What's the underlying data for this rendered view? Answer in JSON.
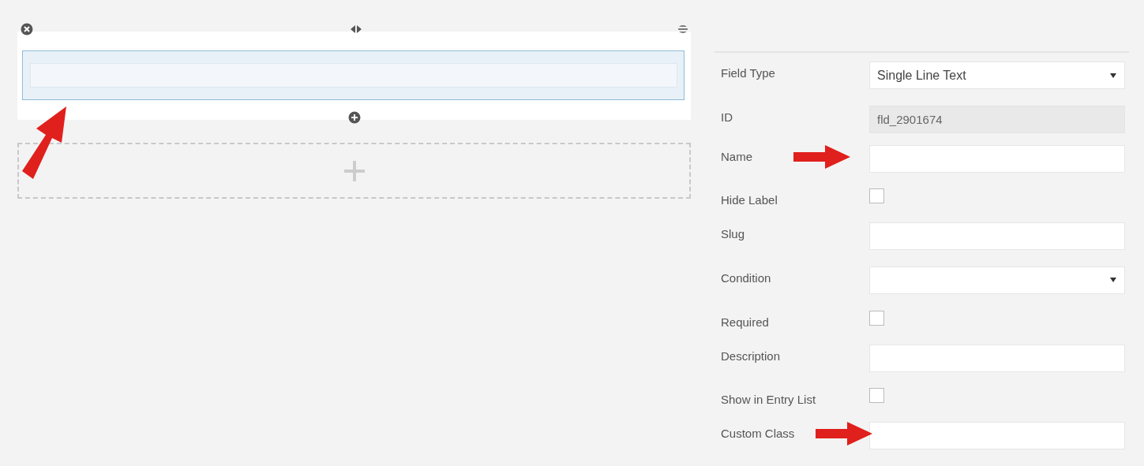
{
  "canvas": {
    "field": {
      "pointed": true
    }
  },
  "settings": {
    "rows": [
      {
        "kind": "select",
        "label": "Field Type",
        "value": "Single Line Text",
        "pointed": false
      },
      {
        "kind": "readonly",
        "label": "ID",
        "value": "fld_2901674",
        "pointed": false
      },
      {
        "kind": "text",
        "label": "Name",
        "pointed": true
      },
      {
        "kind": "checkbox",
        "label": "Hide Label",
        "checked": false,
        "pointed": false
      },
      {
        "kind": "text",
        "label": "Slug",
        "pointed": false
      },
      {
        "kind": "select",
        "label": "Condition",
        "pointed": false
      },
      {
        "kind": "checkbox",
        "label": "Required",
        "checked": false,
        "pointed": false
      },
      {
        "kind": "text",
        "label": "Description",
        "pointed": false
      },
      {
        "kind": "checkbox",
        "label": "Show in Entry List",
        "checked": false,
        "pointed": false
      },
      {
        "kind": "text",
        "label": "Custom Class",
        "pointed": true
      }
    ]
  }
}
